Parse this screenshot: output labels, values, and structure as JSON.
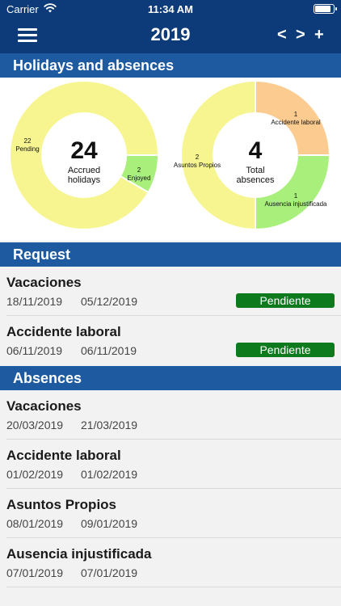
{
  "status_bar": {
    "carrier": "Carrier",
    "time": "11:34 AM",
    "battery_level": 0.92
  },
  "nav": {
    "title": "2019",
    "prev": "<",
    "next": ">",
    "add": "+"
  },
  "sections": {
    "holidays": "Holidays and absences",
    "request": "Request",
    "absences": "Absences"
  },
  "colors": {
    "nav_bg": "#0d3a78",
    "section_bg": "#1e5aa0",
    "pending_yellow": "#f6f590",
    "enjoyed_green": "#a8ef7c",
    "accident_orange": "#fccb90",
    "badge_green": "#0e7a1e"
  },
  "holidays_donut": {
    "center_value": "24",
    "center_label_1": "Accrued",
    "center_label_2": "holidays",
    "slices": [
      {
        "count": "22",
        "label": "Pending",
        "value": 22,
        "color": "#f6f590"
      },
      {
        "count": "2",
        "label": "Enjoyed",
        "value": 2,
        "color": "#a8ef7c"
      }
    ]
  },
  "absences_donut": {
    "center_value": "4",
    "center_label_1": "Total",
    "center_label_2": "absences",
    "slices": [
      {
        "count": "1",
        "label": "Accidente laboral",
        "value": 1,
        "color": "#fccb90"
      },
      {
        "count": "1",
        "label": "Ausencia injustificada",
        "value": 1,
        "color": "#a8ef7c"
      },
      {
        "count": "2",
        "label": "Asuntos Propios",
        "value": 2,
        "color": "#f6f590"
      }
    ]
  },
  "requests": [
    {
      "name": "Vacaciones",
      "start": "18/11/2019",
      "end": "05/12/2019",
      "status": "Pendiente"
    },
    {
      "name": "Accidente laboral",
      "start": "06/11/2019",
      "end": "06/11/2019",
      "status": "Pendiente"
    }
  ],
  "absences": [
    {
      "name": "Vacaciones",
      "start": "20/03/2019",
      "end": "21/03/2019"
    },
    {
      "name": "Accidente laboral",
      "start": "01/02/2019",
      "end": "01/02/2019"
    },
    {
      "name": "Asuntos Propios",
      "start": "08/01/2019",
      "end": "09/01/2019"
    },
    {
      "name": "Ausencia injustificada",
      "start": "07/01/2019",
      "end": "07/01/2019"
    }
  ]
}
